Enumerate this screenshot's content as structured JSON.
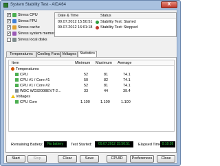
{
  "window": {
    "title": "System Stability Test - AIDA64",
    "close_label": "X"
  },
  "stress_options": [
    {
      "label": "Stress CPU",
      "checked": true,
      "color": "#4caf50"
    },
    {
      "label": "Stress FPU",
      "checked": true,
      "color": "#3f7fd6"
    },
    {
      "label": "Stress cache",
      "checked": true,
      "color": "#e0a030"
    },
    {
      "label": "Stress system memory",
      "checked": true,
      "color": "#9b59b6"
    },
    {
      "label": "Stress local disks",
      "checked": false,
      "color": "#7f8c8d"
    }
  ],
  "log": {
    "headers": {
      "datetime": "Date & Time",
      "status": "Status"
    },
    "rows": [
      {
        "datetime": "09.07.2012 15:50:51",
        "status": "Stability Test: Started",
        "status_color": "#2e9e3e"
      },
      {
        "datetime": "09.07.2012 16:01:18",
        "status": "Stability Test: Stopped",
        "status_color": "#c0392b"
      }
    ]
  },
  "tabs": [
    {
      "label": "Temperatures",
      "active": false
    },
    {
      "label": "Cooling Fans",
      "active": false
    },
    {
      "label": "Voltages",
      "active": false
    },
    {
      "label": "Statistics",
      "active": true
    }
  ],
  "stats": {
    "headers": {
      "item": "Item",
      "min": "Minimum",
      "max": "Maximum",
      "avg": "Average"
    },
    "rows": [
      {
        "kind": "group",
        "item": "Temperatures",
        "icon": "thermometer-icon"
      },
      {
        "kind": "row",
        "item": "CPU",
        "min": "52",
        "max": "81",
        "avg": "74.1",
        "icon": "cpu-icon"
      },
      {
        "kind": "row",
        "item": "CPU #1 / Core #1",
        "min": "50",
        "max": "82",
        "avg": "74.1",
        "icon": "cpu-icon"
      },
      {
        "kind": "row",
        "item": "CPU #1 / Core #2",
        "min": "52",
        "max": "81",
        "avg": "74.1",
        "icon": "cpu-icon"
      },
      {
        "kind": "row",
        "item": "WDC WD3200BEVT-2...",
        "min": "33",
        "max": "44",
        "avg": "39.4",
        "icon": "disk-icon"
      },
      {
        "kind": "group",
        "item": "Voltages",
        "icon": "voltage-icon"
      },
      {
        "kind": "row",
        "item": "CPU Core",
        "min": "1.100",
        "max": "1.100",
        "avg": "1.100",
        "icon": "cpu-icon"
      }
    ]
  },
  "status": {
    "battery_label": "Remaining Battery:",
    "battery_value": "No battery",
    "started_label": "Test Started:",
    "started_value": "09.07.2012 15:50:51",
    "elapsed_label": "Elapsed Time:",
    "elapsed_value": "0:10:26"
  },
  "buttons": {
    "start": "Start",
    "stop": "Stop",
    "clear": "Clear",
    "save": "Save",
    "cpuid": "CPUID",
    "preferences": "Preferences",
    "close": "Close"
  }
}
